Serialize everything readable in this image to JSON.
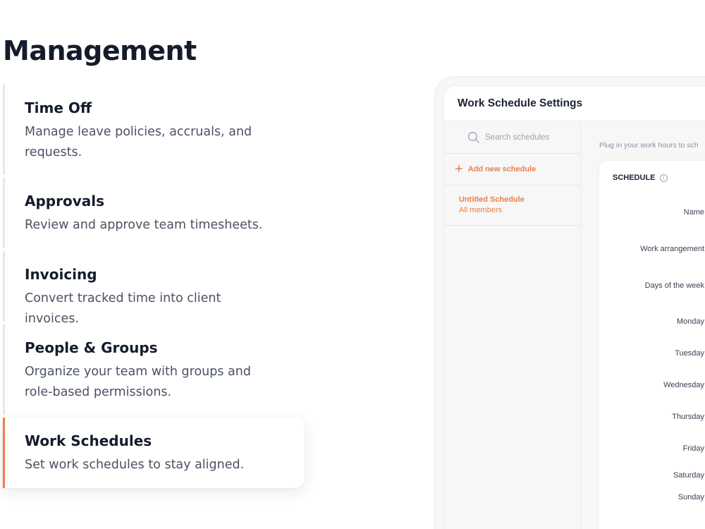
{
  "page": {
    "title": "Management"
  },
  "features": [
    {
      "title": "Time Off",
      "description": "Manage leave policies, accruals, and requests.",
      "active": false
    },
    {
      "title": "Approvals",
      "description": "Review and approve team timesheets.",
      "active": false
    },
    {
      "title": "Invoicing",
      "description": "Convert tracked time into client invoices.",
      "active": false
    },
    {
      "title": "People & Groups",
      "description": "Organize your team with groups and role-based permissions.",
      "active": false
    },
    {
      "title": "Work Schedules",
      "description": "Set work schedules to stay aligned.",
      "active": true
    }
  ],
  "colors": {
    "accent": "#e8804a",
    "heading": "#141c2c",
    "body_text": "#4a5263",
    "divider": "#e5e7eb"
  },
  "mockup": {
    "title": "Work Schedule Settings",
    "search_placeholder": "Search schedules",
    "add_label": "Add new schedule",
    "schedule_item": {
      "name": "Untitled Schedule",
      "sub": "All members"
    },
    "hint": "Plug in your work hours to sch",
    "section_label": "SCHEDULE",
    "fields": {
      "name": "Name",
      "arrangement": "Work arrangement",
      "days": "Days of the week",
      "monday": "Monday",
      "tuesday": "Tuesday",
      "wednesday": "Wednesday",
      "thursday": "Thursday",
      "friday": "Friday",
      "saturday": "Saturday",
      "sunday": "Sunday"
    }
  }
}
